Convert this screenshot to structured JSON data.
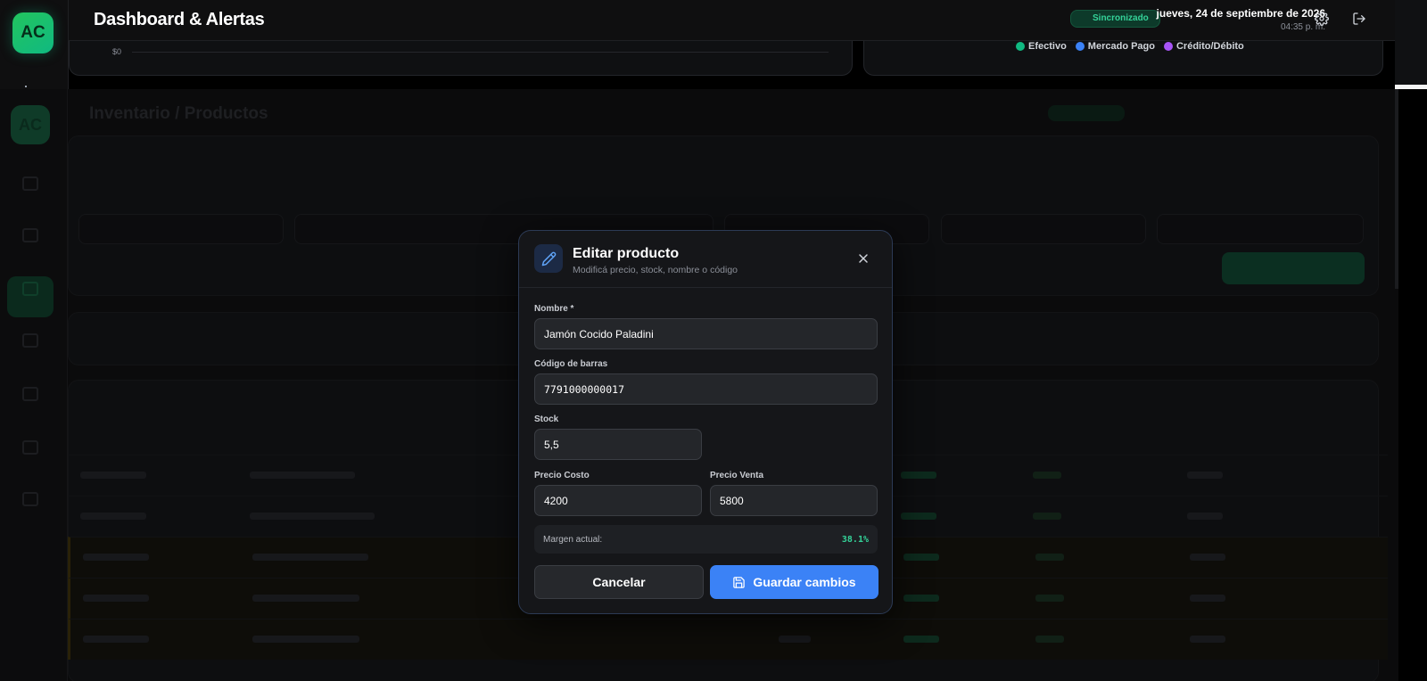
{
  "app": {
    "logo": "AC"
  },
  "header": {
    "title": "Dashboard & Alertas",
    "sync_status": "Sincronizado",
    "date": "jueves, 24 de septiembre de 2026",
    "time": "04:35 p. m.",
    "icons": [
      "settings-icon",
      "logout-icon"
    ]
  },
  "chart": {
    "y_tick_zero": "$0"
  },
  "payment_legend": [
    {
      "label": "Efectivo",
      "color": "#10b981"
    },
    {
      "label": "Mercado Pago",
      "color": "#3b82f6"
    },
    {
      "label": "Crédito/Débito",
      "color": "#a855f7"
    }
  ],
  "background_page": {
    "title": "Inventario / Productos",
    "logo": "AC"
  },
  "modal": {
    "title": "Editar producto",
    "subtitle": "Modificá precio, stock, nombre o código",
    "fields": {
      "name_label": "Nombre *",
      "name_value": "Jamón Cocido Paladini",
      "barcode_label": "Código de barras",
      "barcode_value": "7791000000017",
      "stock_label": "Stock",
      "stock_value": "5,5",
      "cost_label": "Precio Costo",
      "cost_value": "4200",
      "price_label": "Precio Venta",
      "price_value": "5800"
    },
    "margin_label": "Margen actual:",
    "margin_value": "38.1%",
    "cancel_label": "Cancelar",
    "save_label": "Guardar cambios",
    "colors": {
      "accent": "#3b82f6",
      "margin": "#34d399"
    }
  }
}
